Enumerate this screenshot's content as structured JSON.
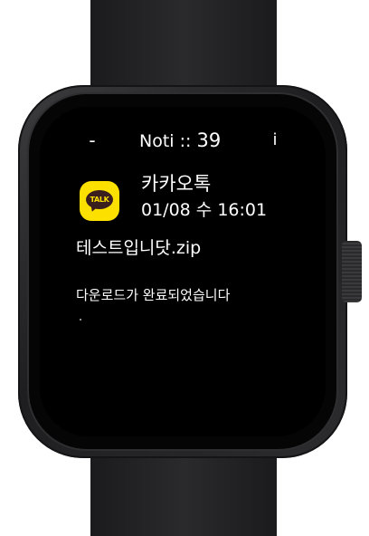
{
  "header": {
    "minus_label": "-",
    "title_prefix": "Noti :: ",
    "count": "39",
    "info_label": "i"
  },
  "notification": {
    "app_icon": "kakaotalk-icon",
    "app_icon_text": "TALK",
    "app_name": "카카오톡",
    "timestamp": "01/08 수 16:01",
    "filename": "테스트입니닷.zip",
    "message": "다운로드가 완료되었습니다"
  },
  "colors": {
    "screen_background": "#000000",
    "text": "#ffffff",
    "kakao_yellow": "#fce100",
    "kakao_brown": "#3b1e1e"
  }
}
